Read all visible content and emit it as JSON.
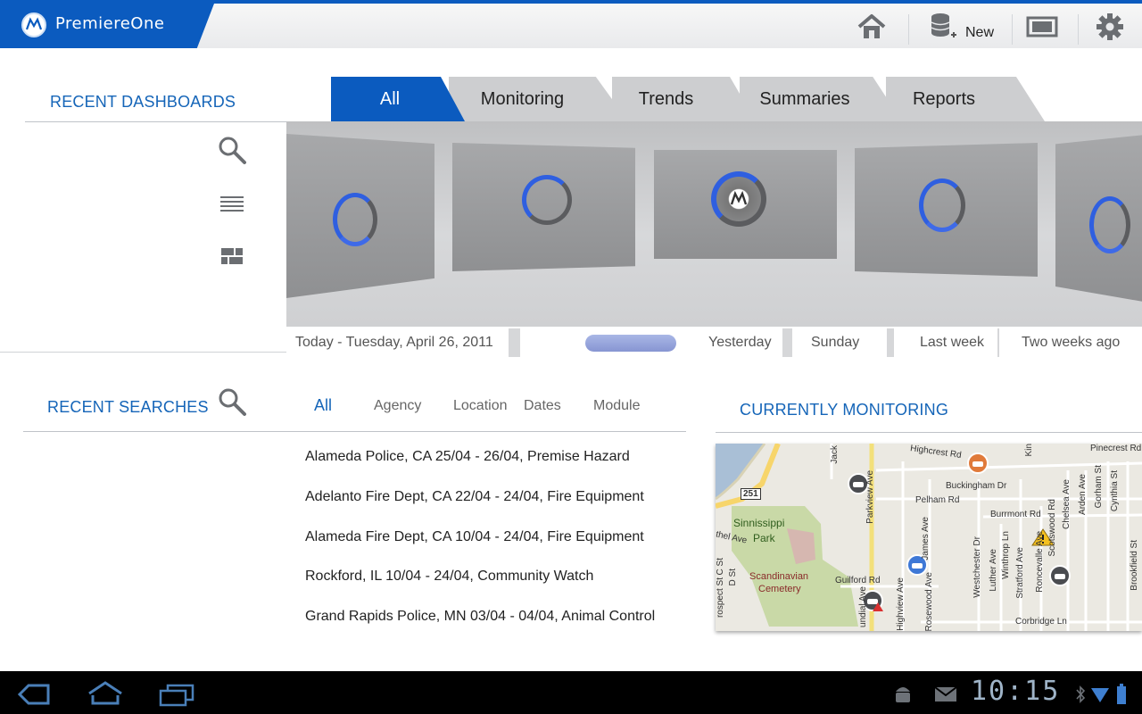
{
  "header": {
    "app_title": "PremiereOne",
    "new_label": "New",
    "icons": [
      "home-icon",
      "new-database-icon",
      "screen-icon",
      "gear-icon"
    ]
  },
  "dashboards": {
    "title": "RECENT DASHBOARDS",
    "side_icons": [
      "search-icon",
      "list-view-icon",
      "grid-view-icon"
    ],
    "tabs": [
      {
        "label": "All",
        "active": true
      },
      {
        "label": "Monitoring",
        "active": false
      },
      {
        "label": "Trends",
        "active": false
      },
      {
        "label": "Summaries",
        "active": false
      },
      {
        "label": "Reports",
        "active": false
      }
    ],
    "timeline": {
      "today": "Today - Tuesday, April 26, 2011",
      "yesterday": "Yesterday",
      "sunday": "Sunday",
      "last_week": "Last week",
      "two_weeks": "Two weeks  ago"
    }
  },
  "searches": {
    "title": "RECENT SEARCHES",
    "filters": [
      "All",
      "Agency",
      "Location",
      "Dates",
      "Module"
    ],
    "results": [
      "Alameda Police, CA  25/04 - 26/04, Premise Hazard",
      "Adelanto Fire Dept, CA  22/04 - 24/04, Fire Equipment",
      "Alameda Fire Dept, CA  10/04 - 24/04, Fire Equipment",
      "Rockford, IL  10/04 - 24/04, Community Watch",
      "Grand Rapids Police, MN 03/04 - 04/04, Animal Control"
    ]
  },
  "monitoring": {
    "title": "CURRENTLY MONITORING",
    "map_labels": {
      "highcrest": "Highcrest Rd",
      "pinecrest": "Pinecrest Rd",
      "buckingham": "Buckingham Dr",
      "pelham": "Pelham Rd",
      "burrmont": "Burrmont Rd",
      "sinnissippi": "Sinnissippi",
      "park": "Park",
      "scandinavian": "Scandinavian",
      "cemetery": "Cemetery",
      "guilford": "Guilford Rd",
      "corbridge": "Corbridge Ln",
      "route": "251",
      "parkview": "Parkview Ave",
      "james": "James Ave",
      "westchester": "Westchester Dr",
      "luther": "Luther Ave",
      "winthrop": "Winthrop Ln",
      "stratford": "Stratford Ave",
      "roncevalle": "Roncevalle Ave",
      "scotswood": "Scotswood Rd",
      "chelsea": "Chelsea Ave",
      "arden": "Arden Ave",
      "gorham": "Gorham St",
      "cynthia": "Cynthia St",
      "brookfield": "Brookfield St",
      "highview": "Highview Ave",
      "rosewood": "Rosewood Ave",
      "jacks": "Jack",
      "kin": "Kin",
      "ethel": "thel Ave",
      "cst": "C St",
      "dst": "D St",
      "prospect": "rospect St",
      "undial": "undial Ave"
    }
  },
  "status_bar": {
    "time": "10:15",
    "icons": [
      "back-icon",
      "home-icon",
      "recent-apps-icon",
      "android-icon",
      "mail-icon",
      "bluetooth-icon",
      "wifi-icon",
      "battery-icon"
    ]
  }
}
